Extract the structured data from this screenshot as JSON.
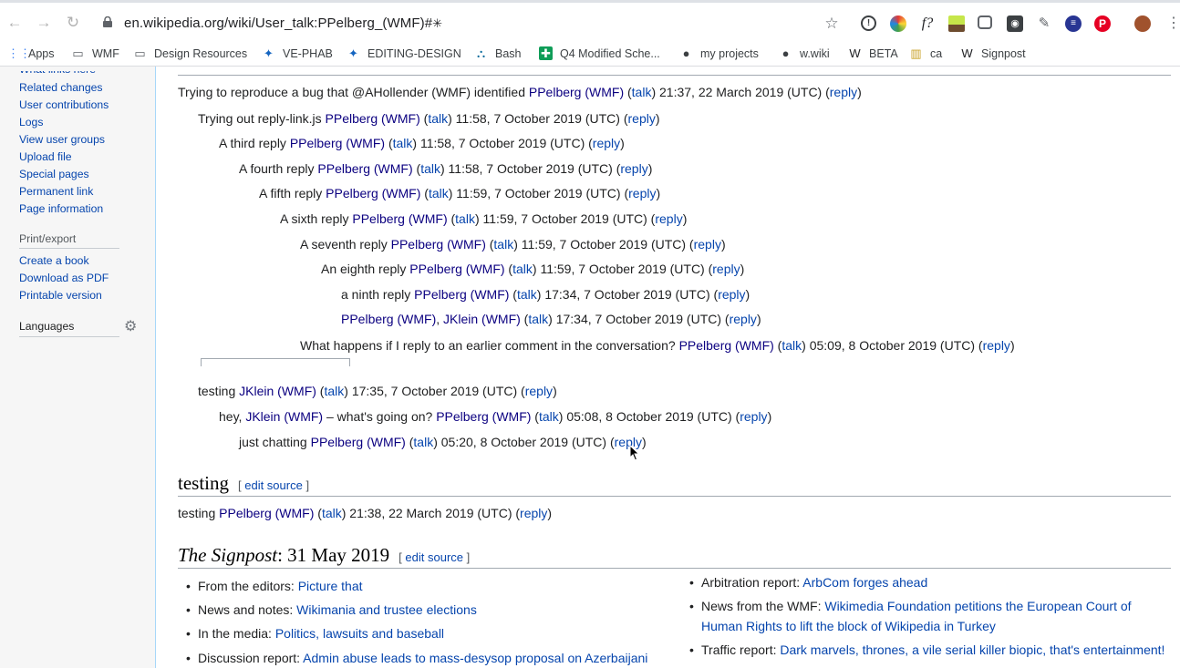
{
  "browser": {
    "url_host": "en.wikipedia.org",
    "url_path": "/wiki/User_talk:PPelberg_(WMF)#"
  },
  "bookmarks": [
    {
      "label": "Apps",
      "icon": "apps-grid-icon"
    },
    {
      "label": "WMF",
      "icon": "folder-icon"
    },
    {
      "label": "Design Resources",
      "icon": "folder-icon"
    },
    {
      "label": "VE-PHAB",
      "icon": "phabricator-icon"
    },
    {
      "label": "EDITING-DESIGN",
      "icon": "phabricator-icon"
    },
    {
      "label": "Bash",
      "icon": "wikimedia-icon"
    },
    {
      "label": "Q4 Modified Sche...",
      "icon": "sheets-icon"
    },
    {
      "label": "my projects",
      "icon": "globe-icon"
    },
    {
      "label": "w.wiki",
      "icon": "globe-icon"
    },
    {
      "label": "BETA",
      "icon": "wikipedia-w-icon"
    },
    {
      "label": "ca",
      "icon": "ca-icon"
    },
    {
      "label": "Signpost",
      "icon": "wikipedia-w-icon"
    }
  ],
  "sidebar": {
    "tools": [
      "What links here",
      "Related changes",
      "User contributions",
      "Logs",
      "View user groups",
      "Upload file",
      "Special pages",
      "Permanent link",
      "Page information"
    ],
    "print_heading": "Print/export",
    "print": [
      "Create a book",
      "Download as PDF",
      "Printable version"
    ],
    "languages_heading": "Languages"
  },
  "thread": [
    {
      "text": "Trying to reproduce a bug that @AHollender (WMF) identified",
      "user": "PPelberg (WMF)",
      "user2": "",
      "ts": "21:37, 22 March 2019 (UTC)"
    },
    {
      "text": "Trying out reply-link.js",
      "user": "PPelberg (WMF)",
      "user2": "",
      "ts": "11:58, 7 October 2019 (UTC)"
    },
    {
      "text": "A third reply",
      "user": "PPelberg (WMF)",
      "user2": "",
      "ts": "11:58, 7 October 2019 (UTC)"
    },
    {
      "text": "A fourth reply",
      "user": "PPelberg (WMF)",
      "user2": "",
      "ts": "11:58, 7 October 2019 (UTC)"
    },
    {
      "text": "A fifth reply",
      "user": "PPelberg (WMF)",
      "user2": "",
      "ts": "11:59, 7 October 2019 (UTC)"
    },
    {
      "text": "A sixth reply",
      "user": "PPelberg (WMF)",
      "user2": "",
      "ts": "11:59, 7 October 2019 (UTC)"
    },
    {
      "text": "A seventh reply",
      "user": "PPelberg (WMF)",
      "user2": "",
      "ts": "11:59, 7 October 2019 (UTC)"
    },
    {
      "text": "An eighth reply",
      "user": "PPelberg (WMF)",
      "user2": "",
      "ts": "11:59, 7 October 2019 (UTC)"
    },
    {
      "text": "a ninth reply",
      "user": "PPelberg (WMF)",
      "user2": "",
      "ts": "17:34, 7 October 2019 (UTC)"
    },
    {
      "text": "",
      "user": "PPelberg (WMF)",
      "user2": "JKlein (WMF)",
      "ts": "17:34, 7 October 2019 (UTC)"
    },
    {
      "text": "What happens if I reply to an earlier comment in the conversation?",
      "user": "PPelberg (WMF)",
      "user2": "",
      "ts": "05:09, 8 October 2019 (UTC)"
    },
    {
      "text": "testing",
      "user": "JKlein (WMF)",
      "user2": "",
      "ts": "17:35, 7 October 2019 (UTC)"
    },
    {
      "text": "hey,",
      "user": "PPelberg (WMF)",
      "user2": "JKlein (WMF)",
      "mid": "– what's going on?",
      "ts": "05:08, 8 October 2019 (UTC)"
    },
    {
      "text": "just chatting",
      "user": "PPelberg (WMF)",
      "user2": "",
      "ts": "05:20, 8 October 2019 (UTC)"
    }
  ],
  "talk_label": "talk",
  "reply_label": "reply",
  "section_testing": {
    "heading": "testing",
    "edit_source": "edit source",
    "text": "testing",
    "user": "PPelberg (WMF)",
    "ts": "21:38, 22 March 2019 (UTC)"
  },
  "signpost": {
    "heading_italic": "The Signpost",
    "heading_rest": ": 31 May 2019",
    "edit_source": "edit source",
    "left": [
      {
        "label": "From the editors:",
        "link": "Picture that"
      },
      {
        "label": "News and notes:",
        "link": "Wikimania and trustee elections"
      },
      {
        "label": "In the media:",
        "link": "Politics, lawsuits and baseball"
      },
      {
        "label": "Discussion report:",
        "link": "Admin abuse leads to mass-desysop proposal on Azerbaijani"
      }
    ],
    "right": [
      {
        "label": "Arbitration report:",
        "link": "ArbCom forges ahead",
        "link2": ""
      },
      {
        "label": "News from the WMF:",
        "link": "Wikimedia Foundation petitions the European Court of",
        "link2": "Human Rights to lift the block of Wikipedia in Turkey"
      },
      {
        "label": "Traffic report:",
        "link": "Dark marvels, thrones, a vile serial killer biopic, that's entertainment!",
        "link2": ""
      }
    ]
  }
}
